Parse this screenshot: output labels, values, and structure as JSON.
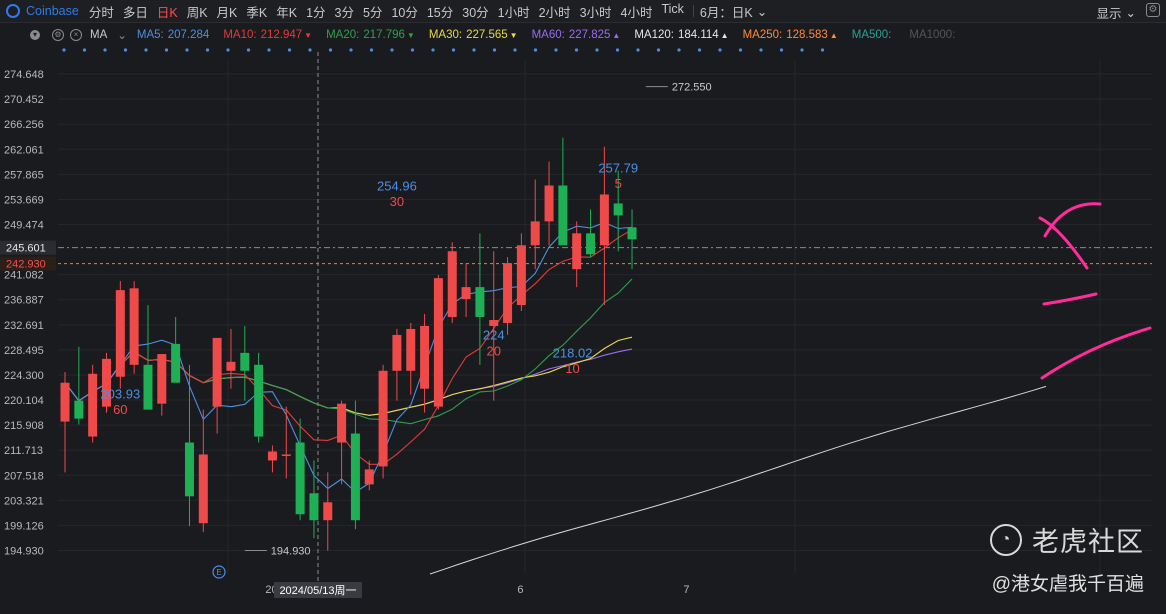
{
  "toolbar": {
    "ticker": "Coinbase",
    "timeframes": [
      "分时",
      "多日",
      "日K",
      "周K",
      "月K",
      "季K",
      "年K",
      "1分",
      "3分",
      "5分",
      "10分",
      "15分",
      "30分",
      "1小时",
      "2小时",
      "3小时",
      "4小时",
      "Tick"
    ],
    "active_timeframe": "日K",
    "period_label": "6月：日K",
    "display_label": "显示"
  },
  "ma_bar": {
    "type_label": "MA",
    "items": [
      {
        "label": "MA5:",
        "value": "207.284",
        "color": "#4a90e2",
        "arrow": ""
      },
      {
        "label": "MA10:",
        "value": "212.947",
        "color": "#e23b3b",
        "arrow": "▼"
      },
      {
        "label": "MA20:",
        "value": "217.796",
        "color": "#2ea04a",
        "arrow": "▼"
      },
      {
        "label": "MA30:",
        "value": "227.565",
        "color": "#e8d84a",
        "arrow": "▼"
      },
      {
        "label": "MA60:",
        "value": "227.825",
        "color": "#9b6cf0",
        "arrow": "▲"
      },
      {
        "label": "MA120:",
        "value": "184.114",
        "color": "#e6e6e6",
        "arrow": "▲"
      },
      {
        "label": "MA250:",
        "value": "128.583",
        "color": "#ff8a3d",
        "arrow": "▲"
      },
      {
        "label": "MA500:",
        "value": "",
        "color": "#2aa198",
        "arrow": ""
      },
      {
        "label": "MA1000:",
        "value": "",
        "color": "#555555",
        "arrow": ""
      }
    ]
  },
  "colors": {
    "up": "#ef4a4a",
    "down": "#1fb055",
    "background": "#1a1b1f",
    "grid": "#2a2b30",
    "annotation": "#ff2d9b"
  },
  "watermark": {
    "brand": "老虎社区",
    "author": "@港女虐我千百遍"
  },
  "chart_data": {
    "type": "candlestick",
    "y_ticks": [
      274.648,
      270.452,
      266.256,
      262.061,
      257.865,
      253.669,
      249.474,
      245.601,
      242.93,
      241.082,
      236.887,
      232.691,
      228.495,
      224.3,
      220.104,
      215.908,
      211.713,
      207.518,
      203.321,
      199.126,
      194.93
    ],
    "ylim": [
      191.0,
      277.0
    ],
    "x_labels": [
      {
        "label": "2024/05",
        "index": 4
      },
      {
        "label": "6",
        "index": 21
      },
      {
        "label": "7",
        "index": 33
      }
    ],
    "crosshair": {
      "index": 6,
      "label": "2024/05/13周一"
    },
    "current_price": "245.601",
    "marked_price": "242.930",
    "annotations": [
      {
        "text": "254.96",
        "index": 24,
        "y": 255.2,
        "color": "#4a90e2"
      },
      {
        "text": "30",
        "index": 24,
        "y": 252.6,
        "color": "#ef4a4a"
      },
      {
        "text": "257.79",
        "index": 40,
        "y": 258.2,
        "color": "#4a90e2"
      },
      {
        "text": "5",
        "index": 40,
        "y": 255.6,
        "color": "#ef4a4a"
      },
      {
        "text": "203.93",
        "index": 4.0,
        "y": 220.4,
        "color": "#4a90e2"
      },
      {
        "text": "60",
        "index": 4.0,
        "y": 217.8,
        "color": "#ef4a4a"
      },
      {
        "text": "224",
        "index": 31,
        "y": 230.2,
        "color": "#4a90e2"
      },
      {
        "text": "20",
        "index": 31,
        "y": 227.6,
        "color": "#ef4a4a"
      },
      {
        "text": "218.02",
        "index": 36.7,
        "y": 227.2,
        "color": "#4a90e2"
      },
      {
        "text": "10",
        "index": 36.7,
        "y": 224.6,
        "color": "#ef4a4a"
      }
    ],
    "extreme_labels": [
      {
        "text": "272.550",
        "index": 42,
        "price": 272.55
      },
      {
        "text": "194.930",
        "index": 13,
        "price": 194.93
      }
    ],
    "candles": [
      {
        "o": 216.5,
        "h": 224.8,
        "l": 208.0,
        "c": 223.0
      },
      {
        "o": 220.0,
        "h": 229.0,
        "l": 216.0,
        "c": 217.0
      },
      {
        "o": 214.0,
        "h": 226.0,
        "l": 213.0,
        "c": 224.5
      },
      {
        "o": 219.0,
        "h": 228.0,
        "l": 218.0,
        "c": 227.0
      },
      {
        "o": 224.0,
        "h": 240.0,
        "l": 222.0,
        "c": 238.5
      },
      {
        "o": 226.0,
        "h": 240.0,
        "l": 224.5,
        "c": 238.8
      },
      {
        "o": 226.0,
        "h": 236.0,
        "l": 219.0,
        "c": 218.5
      },
      {
        "o": 219.5,
        "h": 227.5,
        "l": 217.5,
        "c": 227.8
      },
      {
        "o": 229.5,
        "h": 234.0,
        "l": 225.0,
        "c": 223.0
      },
      {
        "o": 213.0,
        "h": 226.0,
        "l": 199.0,
        "c": 204.0
      },
      {
        "o": 199.5,
        "h": 218.5,
        "l": 198.0,
        "c": 211.0
      },
      {
        "o": 219.0,
        "h": 230.0,
        "l": 214.5,
        "c": 230.5
      },
      {
        "o": 225.0,
        "h": 232.0,
        "l": 222.0,
        "c": 226.5
      },
      {
        "o": 228.0,
        "h": 232.5,
        "l": 220.0,
        "c": 225.0
      },
      {
        "o": 226.0,
        "h": 228.0,
        "l": 213.0,
        "c": 214.0
      },
      {
        "o": 210.0,
        "h": 212.5,
        "l": 208.0,
        "c": 211.5
      },
      {
        "o": 211.0,
        "h": 219.0,
        "l": 207.0,
        "c": 211.0
      },
      {
        "o": 213.0,
        "h": 217.0,
        "l": 200.0,
        "c": 201.0
      },
      {
        "o": 204.5,
        "h": 210.0,
        "l": 197.0,
        "c": 200.0
      },
      {
        "o": 200.0,
        "h": 208.0,
        "l": 194.9,
        "c": 203.0
      },
      {
        "o": 213.0,
        "h": 220.0,
        "l": 206.0,
        "c": 219.5
      },
      {
        "o": 214.5,
        "h": 220.0,
        "l": 198.5,
        "c": 200.0
      },
      {
        "o": 206.0,
        "h": 210.0,
        "l": 205.0,
        "c": 208.5
      },
      {
        "o": 209.0,
        "h": 226.0,
        "l": 207.0,
        "c": 225.0
      },
      {
        "o": 225.0,
        "h": 232.0,
        "l": 220.0,
        "c": 231.0
      },
      {
        "o": 225.0,
        "h": 233.0,
        "l": 221.0,
        "c": 232.0
      },
      {
        "o": 222.0,
        "h": 234.5,
        "l": 218.0,
        "c": 232.5
      },
      {
        "o": 219.0,
        "h": 241.0,
        "l": 218.5,
        "c": 240.5
      },
      {
        "o": 234.0,
        "h": 246.5,
        "l": 233.0,
        "c": 245.0
      },
      {
        "o": 237.0,
        "h": 243.0,
        "l": 234.0,
        "c": 239.0
      },
      {
        "o": 239.0,
        "h": 248.0,
        "l": 226.0,
        "c": 234.0
      },
      {
        "o": 232.5,
        "h": 245.0,
        "l": 220.0,
        "c": 233.5
      },
      {
        "o": 233.0,
        "h": 244.0,
        "l": 231.0,
        "c": 243.0
      },
      {
        "o": 236.0,
        "h": 248.0,
        "l": 235.0,
        "c": 246.0
      },
      {
        "o": 246.0,
        "h": 257.0,
        "l": 242.0,
        "c": 250.0
      },
      {
        "o": 250.0,
        "h": 260.0,
        "l": 246.0,
        "c": 256.0
      },
      {
        "o": 256.0,
        "h": 264.0,
        "l": 248.0,
        "c": 246.0
      },
      {
        "o": 242.0,
        "h": 250.0,
        "l": 239.0,
        "c": 248.0
      },
      {
        "o": 248.0,
        "h": 252.0,
        "l": 244.0,
        "c": 244.5
      },
      {
        "o": 246.0,
        "h": 262.5,
        "l": 236.0,
        "c": 254.5
      },
      {
        "o": 253.0,
        "h": 258.5,
        "l": 245.0,
        "c": 251.0
      },
      {
        "o": 249.0,
        "h": 252.0,
        "l": 242.0,
        "c": 247.0
      }
    ]
  }
}
